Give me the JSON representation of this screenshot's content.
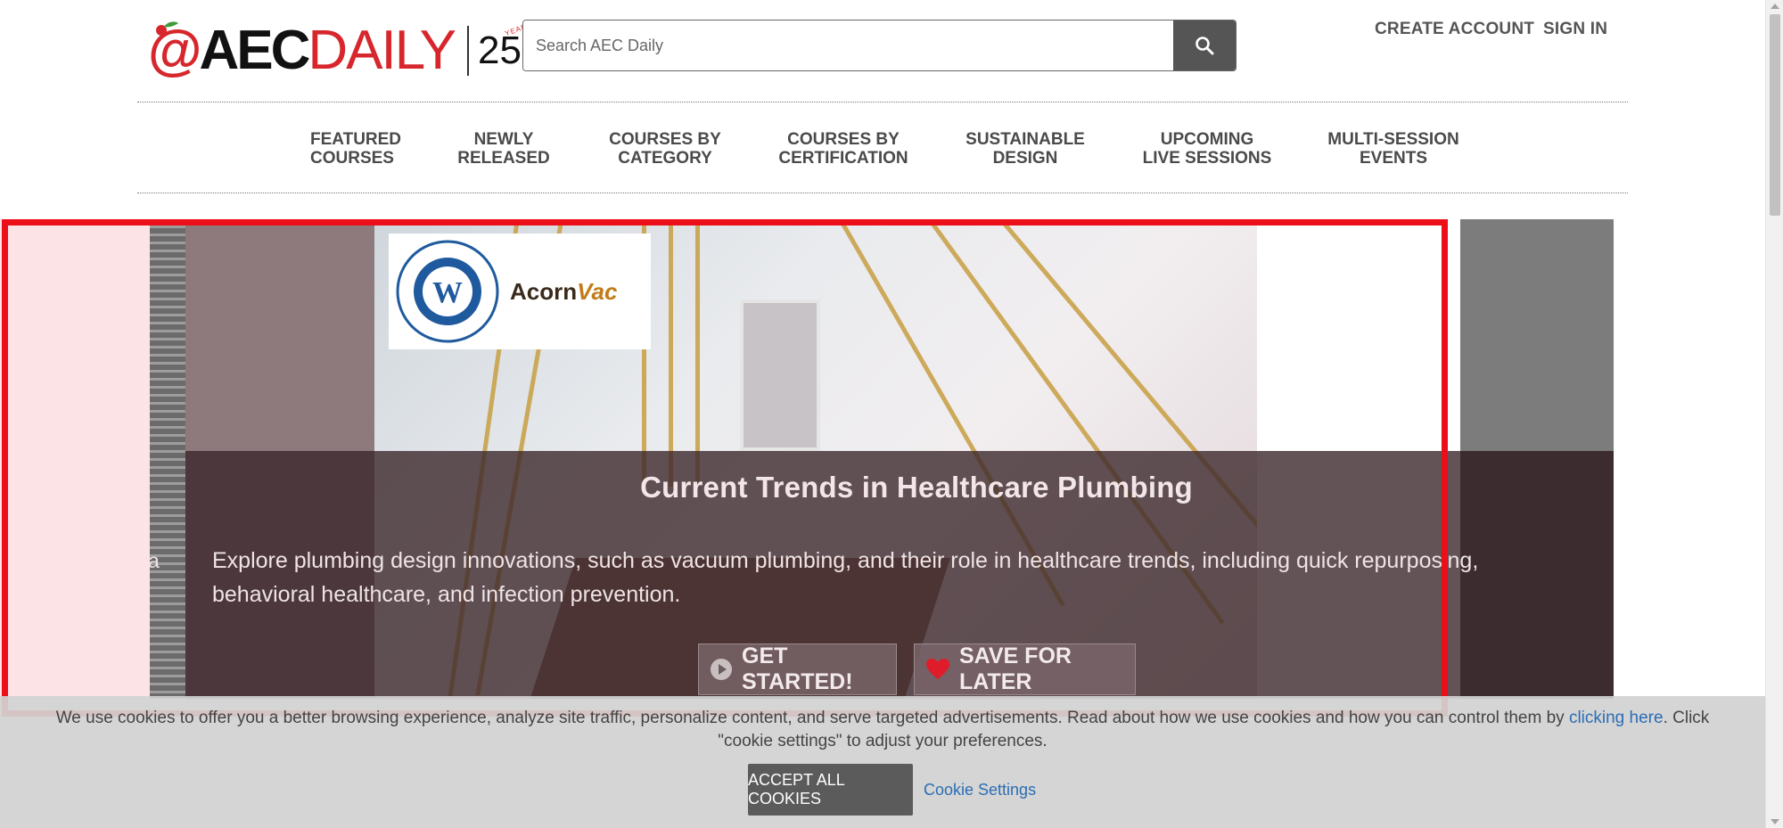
{
  "header": {
    "logo": {
      "brand_at": "@",
      "brand_aec": "AEC",
      "brand_daily": "DAILY",
      "years_two": "2",
      "years_five": "5",
      "years_tag": "YEARS"
    },
    "search_placeholder": "Search AEC Daily",
    "search_icon": "search-icon",
    "create_account": "CREATE ACCOUNT",
    "sign_in": "SIGN IN"
  },
  "nav": {
    "items": [
      {
        "label": "FEATURED\nCOURSES"
      },
      {
        "label": "NEWLY\nRELEASED"
      },
      {
        "label": "COURSES BY\nCATEGORY"
      },
      {
        "label": "COURSES BY\nCERTIFICATION"
      },
      {
        "label": "SUSTAINABLE\nDESIGN"
      },
      {
        "label": "UPCOMING\nLIVE SESSIONS"
      },
      {
        "label": "MULTI-SESSION\nEVENTS"
      }
    ]
  },
  "hero": {
    "sponsor_acorn": "Acorn",
    "sponsor_vac": "Vac",
    "side_letter": "a",
    "title": "Current Trends in Healthcare Plumbing",
    "description": "Explore plumbing design innovations, such as vacuum plumbing, and their role in healthcare trends, including quick repurposing, behavioral healthcare, and infection prevention.",
    "get_started": "GET STARTED!",
    "save_for_later": "SAVE FOR LATER",
    "play_icon": "play-circle-icon",
    "heart_icon": "heart-icon"
  },
  "cookie": {
    "text_before": "We use cookies to offer you a better browsing experience, analyze site traffic, personalize content, and serve targeted advertisements. Read about how we use cookies and how you can control them by ",
    "link": "clicking here",
    "text_after": ". Click \"cookie settings\" to adjust your preferences.",
    "accept": "ACCEPT ALL COOKIES",
    "settings": "Cookie Settings"
  },
  "colors": {
    "brand_red": "#d7262c",
    "highlight_box": "#ec0f1a",
    "link_blue": "#2a6db4"
  }
}
